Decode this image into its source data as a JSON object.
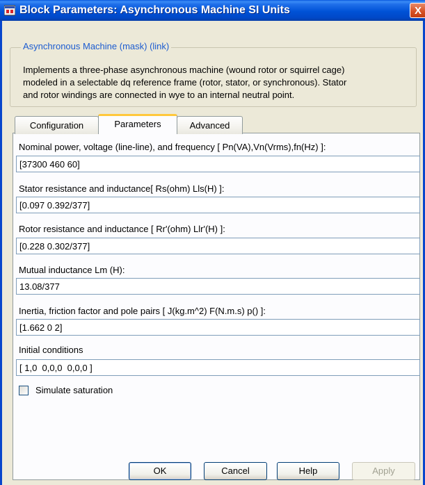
{
  "window": {
    "title": "Block Parameters: Asynchronous Machine SI Units",
    "close_glyph": "X"
  },
  "description": {
    "group_title": "Asynchronous Machine (mask) (link)",
    "lines": [
      "Implements a three-phase asynchronous machine (wound rotor or squirrel cage)",
      "modeled in a selectable  dq reference frame (rotor, stator, or synchronous). Stator",
      "and rotor windings are connected in wye to an internal neutral point."
    ]
  },
  "tabs": [
    {
      "label": "Configuration",
      "active": false
    },
    {
      "label": "Parameters",
      "active": true
    },
    {
      "label": "Advanced",
      "active": false
    }
  ],
  "fields": [
    {
      "label": "Nominal power, voltage (line-line), and frequency [ Pn(VA),Vn(Vrms),fn(Hz) ]:",
      "value": "[37300 460 60]"
    },
    {
      "label": "Stator resistance and inductance[ Rs(ohm)  Lls(H) ]:",
      "value": "[0.097 0.392/377]"
    },
    {
      "label": "Rotor resistance and inductance [ Rr'(ohm)  Llr'(H) ]:",
      "value": "[0.228 0.302/377]"
    },
    {
      "label": "Mutual inductance Lm (H):",
      "value": "13.08/377"
    },
    {
      "label": "Inertia, friction factor and pole pairs [ J(kg.m^2)  F(N.m.s)  p() ]:",
      "value": "[1.662 0 2]"
    },
    {
      "label": "Initial conditions",
      "value": "[ 1,0  0,0,0  0,0,0 ]"
    }
  ],
  "saturation": {
    "label": "Simulate saturation",
    "checked": false
  },
  "buttons": {
    "ok": "OK",
    "cancel": "Cancel",
    "help": "Help",
    "apply": "Apply"
  },
  "colors": {
    "titlebar": "#0052d6",
    "group_title": "#1c5cd0",
    "active_tab_accent": "#ffc83c"
  }
}
